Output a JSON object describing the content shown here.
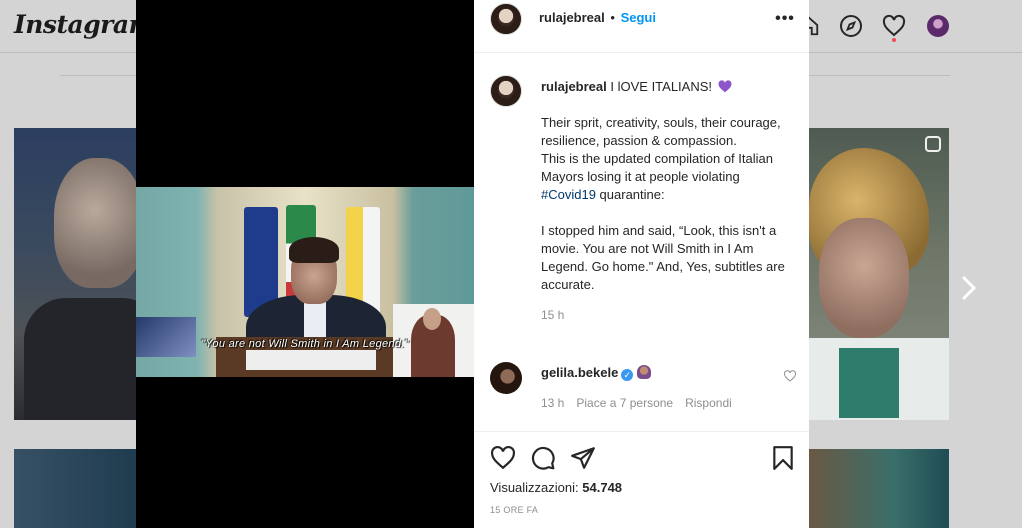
{
  "app": {
    "logo_text": "Instagram"
  },
  "post": {
    "author": "rulajebreal",
    "follow_label": "Segui",
    "separator": "•",
    "more_label": "•••",
    "caption_head": "I lOVE ITALIANS!",
    "caption_body_1": "Their sprit, creativity, souls, their courage, resilience, passion & compassion.\nThis is the updated compilation of Italian Mayors losing it at people violating ",
    "hashtag": "#Covid19",
    "caption_body_2": " quarantine:\n\nI stopped him and said, “Look, this isn't a movie. You are not Will Smith in I Am Legend. Go home.\" And, Yes, subtitles are accurate.",
    "caption_time": "15 h",
    "video_subtitle": "\"You are not Will Smith in I Am Legend.\"",
    "views_label": "Visualizzazioni:",
    "views_count": "54.748",
    "posted_ago": "15 ORE FA"
  },
  "comment": {
    "author": "gelila.bekele",
    "time": "13 h",
    "likes": "Piace a 7 persone",
    "reply_label": "Rispondi"
  },
  "colors": {
    "link": "#0095f6",
    "hashtag": "#00376b",
    "verified": "#3897f0"
  }
}
